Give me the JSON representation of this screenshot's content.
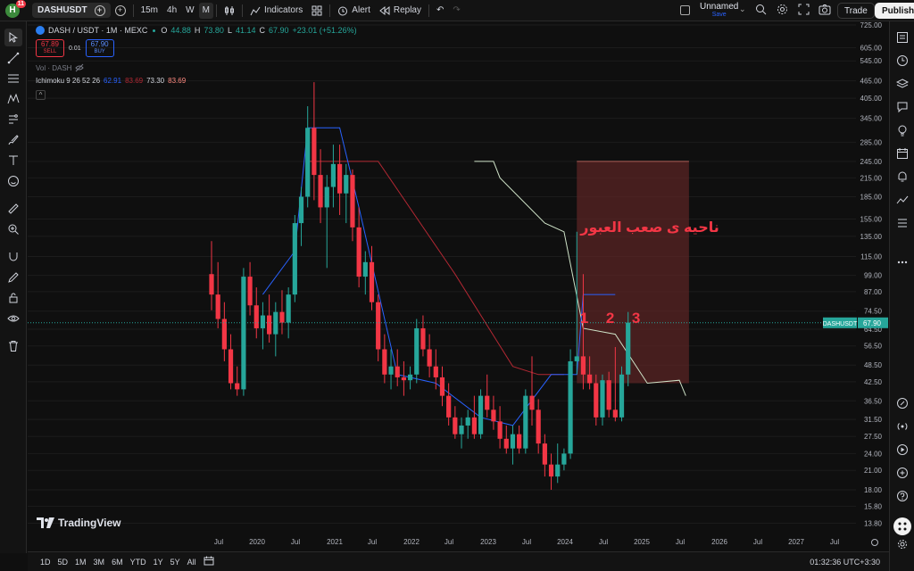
{
  "topbar": {
    "avatar_letter": "H",
    "notification_count": "11",
    "symbol": "DASHUSDT",
    "timeframes": [
      "15m",
      "4h",
      "W",
      "M"
    ],
    "active_timeframe": "M",
    "indicators_label": "Indicators",
    "alert_label": "Alert",
    "replay_label": "Replay",
    "layout_name": "Unnamed",
    "layout_status": "Save",
    "trade_label": "Trade",
    "publish_label": "Publish"
  },
  "legend": {
    "title": "DASH / USDT · 1M · MEXC",
    "o_label": "O",
    "o_value": "44.88",
    "h_label": "H",
    "h_value": "73.80",
    "l_label": "L",
    "l_value": "41.14",
    "c_label": "C",
    "c_value": "67.90",
    "change": "+23.01 (+51.26%)",
    "sell_price": "67.89",
    "sell_label": "SELL",
    "spread": "0.01",
    "buy_price": "67.90",
    "buy_label": "BUY",
    "vol_label": "Vol · DASH",
    "ichimoku_label": "Ichimoku 9 26 52 26",
    "ichimoku_values": [
      "62.91",
      "83.69",
      "73.30",
      "83.69"
    ]
  },
  "colors": {
    "up": "#26a69a",
    "down": "#f23645",
    "conversion": "#2962ff",
    "base": "#b22833",
    "span_b": "#cfe3c8",
    "zone": "#5a2424",
    "annotation": "#f23645",
    "price_tag": "#26a69a"
  },
  "chart_data": {
    "type": "candlestick",
    "scale": "log",
    "ylim": [
      12.8,
      725
    ],
    "y_ticks": [
      "725.00",
      "605.00",
      "545.00",
      "465.00",
      "405.00",
      "345.00",
      "285.00",
      "245.00",
      "215.00",
      "185.00",
      "155.00",
      "135.00",
      "115.00",
      "99.00",
      "87.00",
      "74.50",
      "64.50",
      "56.50",
      "48.50",
      "42.50",
      "36.50",
      "31.50",
      "27.50",
      "24.00",
      "21.00",
      "18.00",
      "15.80",
      "13.80"
    ],
    "x_ticks": [
      "Jul",
      "2020",
      "Jul",
      "2021",
      "Jul",
      "2022",
      "Jul",
      "2023",
      "Jul",
      "2024",
      "Jul",
      "2025",
      "Jul",
      "2026",
      "Jul",
      "2027",
      "Jul"
    ],
    "last_price": "67.90",
    "last_symbol": "DASHUSDT",
    "annotation_text": "ناحیه ی صعب العبور",
    "annotation_numbers": [
      "1",
      "2",
      "3"
    ],
    "candles": [
      [
        100,
        130,
        75,
        85
      ],
      [
        85,
        110,
        65,
        70
      ],
      [
        70,
        80,
        50,
        55
      ],
      [
        55,
        62,
        40,
        42
      ],
      [
        42,
        48,
        38,
        40
      ],
      [
        40,
        105,
        38,
        98
      ],
      [
        98,
        110,
        72,
        78
      ],
      [
        78,
        90,
        60,
        65
      ],
      [
        65,
        80,
        55,
        72
      ],
      [
        72,
        85,
        58,
        62
      ],
      [
        62,
        80,
        52,
        74
      ],
      [
        74,
        88,
        62,
        68
      ],
      [
        68,
        90,
        60,
        85
      ],
      [
        85,
        160,
        80,
        150
      ],
      [
        150,
        200,
        125,
        185
      ],
      [
        185,
        380,
        170,
        320
      ],
      [
        320,
        460,
        180,
        220
      ],
      [
        220,
        270,
        150,
        170
      ],
      [
        170,
        220,
        105,
        200
      ],
      [
        200,
        280,
        170,
        240
      ],
      [
        240,
        280,
        160,
        190
      ],
      [
        190,
        240,
        150,
        220
      ],
      [
        220,
        230,
        130,
        145
      ],
      [
        145,
        170,
        90,
        98
      ],
      [
        98,
        120,
        85,
        110
      ],
      [
        110,
        125,
        75,
        80
      ],
      [
        80,
        85,
        50,
        55
      ],
      [
        55,
        62,
        42,
        45
      ],
      [
        45,
        55,
        40,
        48
      ],
      [
        48,
        55,
        41,
        44
      ],
      [
        44,
        50,
        38,
        43
      ],
      [
        43,
        48,
        40,
        45
      ],
      [
        45,
        70,
        42,
        65
      ],
      [
        65,
        72,
        52,
        55
      ],
      [
        55,
        62,
        44,
        48
      ],
      [
        48,
        55,
        40,
        44
      ],
      [
        44,
        48,
        35,
        38
      ],
      [
        38,
        42,
        30,
        32
      ],
      [
        32,
        35,
        27,
        28
      ],
      [
        28,
        32,
        25,
        30
      ],
      [
        30,
        34,
        27,
        32
      ],
      [
        32,
        38,
        27,
        28
      ],
      [
        28,
        40,
        27,
        38
      ],
      [
        38,
        45,
        32,
        34
      ],
      [
        34,
        38,
        29,
        31
      ],
      [
        31,
        35,
        25,
        27
      ],
      [
        27,
        30,
        24,
        25
      ],
      [
        25,
        30,
        22,
        28
      ],
      [
        28,
        30,
        24,
        25
      ],
      [
        25,
        40,
        24,
        38
      ],
      [
        38,
        52,
        30,
        34
      ],
      [
        34,
        37,
        24,
        26
      ],
      [
        26,
        28,
        20,
        22
      ],
      [
        22,
        24,
        18,
        20
      ],
      [
        20,
        26,
        19,
        22
      ],
      [
        22,
        25,
        21,
        24
      ],
      [
        24,
        55,
        23,
        50
      ],
      [
        50,
        140,
        45,
        52
      ],
      [
        52,
        100,
        40,
        45
      ],
      [
        45,
        52,
        40,
        42
      ],
      [
        42,
        45,
        30,
        32
      ],
      [
        32,
        45,
        30,
        43
      ],
      [
        43,
        46,
        32,
        34
      ],
      [
        34,
        56,
        31,
        32
      ],
      [
        32,
        48,
        31,
        45
      ],
      [
        45,
        74,
        41,
        68
      ]
    ],
    "conversion_line": [
      [
        8,
        85
      ],
      [
        13,
        120
      ],
      [
        15,
        320
      ],
      [
        20,
        320
      ],
      [
        23,
        170
      ],
      [
        29,
        45
      ],
      [
        35,
        42
      ],
      [
        42,
        32
      ],
      [
        47,
        30
      ],
      [
        53,
        45
      ],
      [
        57,
        45
      ],
      [
        58,
        85
      ],
      [
        63,
        85
      ]
    ],
    "base_line": [
      [
        15,
        245
      ],
      [
        26,
        245
      ],
      [
        38,
        100
      ],
      [
        47,
        48
      ],
      [
        51,
        45
      ],
      [
        55,
        45
      ]
    ],
    "span_b_line": [
      [
        41,
        245
      ],
      [
        44,
        245
      ],
      [
        45,
        215
      ],
      [
        52,
        150
      ],
      [
        55,
        140
      ],
      [
        58,
        65
      ],
      [
        63,
        62
      ],
      [
        68,
        42
      ],
      [
        73,
        43
      ],
      [
        74,
        38
      ]
    ],
    "zone": {
      "x_start": 57,
      "x_end": 74.5,
      "y_top": 245,
      "y_bottom": 42
    }
  },
  "bottombar": {
    "ranges": [
      "1D",
      "5D",
      "1M",
      "3M",
      "6M",
      "YTD",
      "1Y",
      "5Y",
      "All"
    ],
    "time": "01:32:36 UTC+3:30"
  },
  "logo_text": "TradingView"
}
